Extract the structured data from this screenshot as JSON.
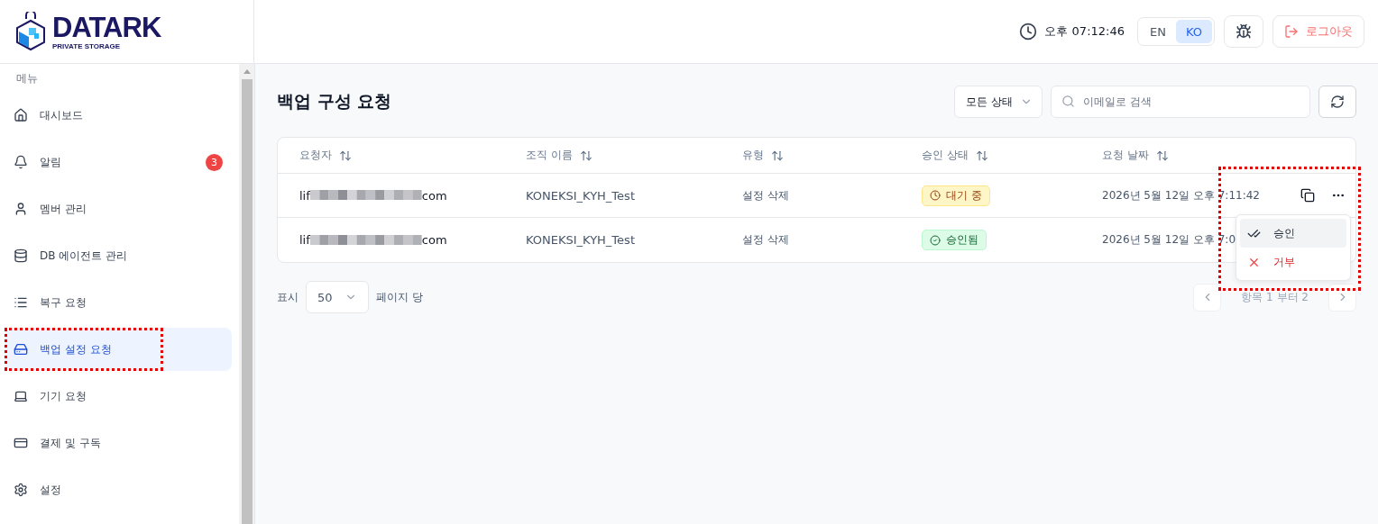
{
  "logo": {
    "name": "DATARK",
    "tagline": "PRIVATE STORAGE"
  },
  "header": {
    "clock": "오후 07:12:46",
    "languages": [
      {
        "label": "EN",
        "selected": false
      },
      {
        "label": "KO",
        "selected": true
      }
    ],
    "logout": "로그아웃"
  },
  "sidebar": {
    "section": "메뉴",
    "items": [
      {
        "label": "대시보드",
        "selected": false,
        "annotated": false
      },
      {
        "label": "알림",
        "selected": false,
        "annotated": false,
        "badge": "3"
      },
      {
        "label": "멤버 관리",
        "selected": false,
        "annotated": false
      },
      {
        "label": "DB 에이전트 관리",
        "selected": false,
        "annotated": false
      },
      {
        "label": "복구 요청",
        "selected": false,
        "annotated": false
      },
      {
        "label": "백업 설정 요청",
        "selected": true,
        "annotated": true
      },
      {
        "label": "기기 요청",
        "selected": false,
        "annotated": false
      },
      {
        "label": "결제 및 구독",
        "selected": false,
        "annotated": false
      },
      {
        "label": "설정",
        "selected": false,
        "annotated": false
      }
    ]
  },
  "page": {
    "title": "백업 구성 요청",
    "status_filter": "모든 상태",
    "search": {
      "placeholder": "이메일로 검색"
    }
  },
  "table": {
    "columns": [
      "요청자",
      "조직 이름",
      "유형",
      "승인 상태",
      "요청 날짜"
    ],
    "rows": [
      {
        "requester_start": "lif",
        "requester_end": "com",
        "organization": "KONEKSI_KYH_Test",
        "type": "설정 삭제",
        "status": {
          "kind": "pending",
          "label": "대기 중"
        },
        "date": "2026년 5월 12일 오후 7:11:42",
        "actions": true
      },
      {
        "requester_start": "lif",
        "requester_end": "com",
        "organization": "KONEKSI_KYH_Test",
        "type": "설정 삭제",
        "status": {
          "kind": "approved",
          "label": "승인됨"
        },
        "date": "2026년 5월 12일 오후 7:0",
        "actions": false
      }
    ],
    "action_menu": {
      "annotated": true,
      "items": [
        {
          "kind": "approve",
          "label": "승인",
          "selected": true
        },
        {
          "kind": "reject",
          "label": "거부",
          "selected": false
        }
      ]
    }
  },
  "footer": {
    "show_label": "표시",
    "page_size": "50",
    "per_page_label": "페이지 당",
    "range": "항목 1 부터 2"
  }
}
